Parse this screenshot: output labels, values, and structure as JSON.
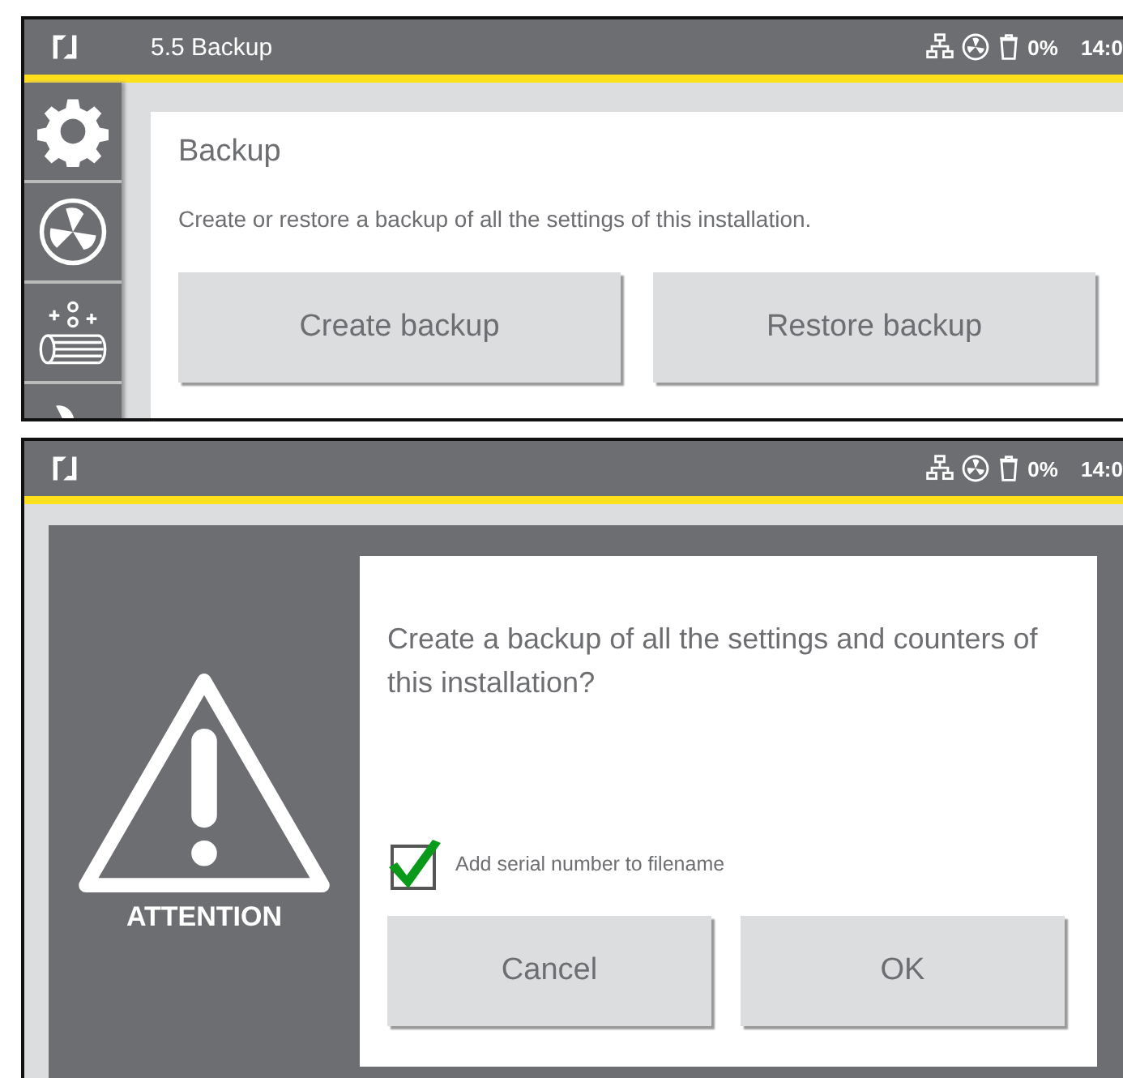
{
  "screens": [
    {
      "header": {
        "title": "5.5 Backup",
        "storage": "0%",
        "time": "14:0"
      },
      "card": {
        "heading": "Backup",
        "description": "Create or restore a backup of all the settings of this installation.",
        "buttons": [
          "Create backup",
          "Restore backup"
        ]
      }
    },
    {
      "header": {
        "storage": "0%",
        "time": "14:0"
      },
      "dialog": {
        "attention": "ATTENTION",
        "question": "Create a backup of all the settings and counters of this installation?",
        "checkbox": {
          "label": "Add serial number to filename",
          "checked": true
        },
        "buttons": [
          "Cancel",
          "OK"
        ]
      }
    }
  ]
}
